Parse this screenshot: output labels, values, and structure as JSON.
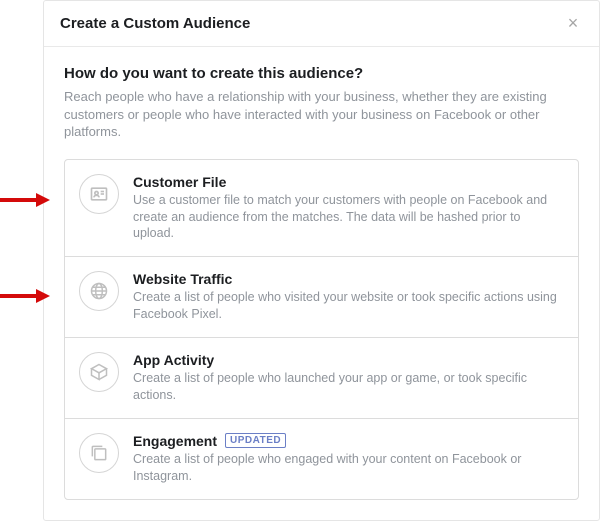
{
  "modal_title": "Create a Custom Audience",
  "close_label": "×",
  "question": "How do you want to create this audience?",
  "subtext": "Reach people who have a relationship with your business, whether they are existing customers or people who have interacted with your business on Facebook or other platforms.",
  "options": [
    {
      "title": "Customer File",
      "desc": "Use a customer file to match your customers with people on Facebook and create an audience from the matches. The data will be hashed prior to upload."
    },
    {
      "title": "Website Traffic",
      "desc": "Create a list of people who visited your website or took specific actions using Facebook Pixel."
    },
    {
      "title": "App Activity",
      "desc": "Create a list of people who launched your app or game, or took specific actions."
    },
    {
      "title": "Engagement",
      "desc": "Create a list of people who engaged with your content on Facebook or Instagram.",
      "badge": "UPDATED"
    }
  ]
}
